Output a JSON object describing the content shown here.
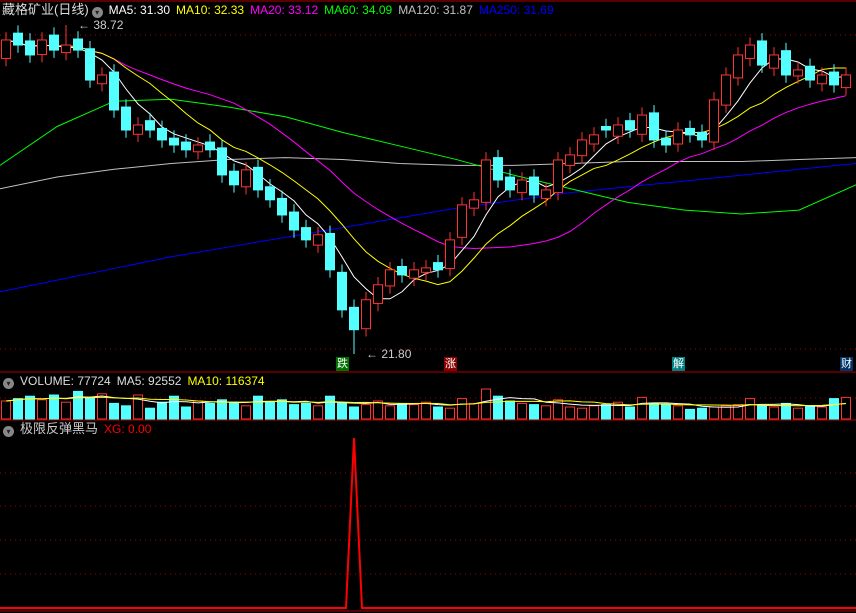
{
  "header": {
    "title": "藏格矿业(日线)",
    "ma": [
      {
        "label": "MA5: 31.30",
        "color": "#ffffff"
      },
      {
        "label": "MA10: 32.33",
        "color": "#ffff00"
      },
      {
        "label": "MA20: 33.12",
        "color": "#ff00ff"
      },
      {
        "label": "MA60: 34.09",
        "color": "#00ff00"
      },
      {
        "label": "MA120: 31.87",
        "color": "#c0c0c0"
      },
      {
        "label": "MA250: 31.69",
        "color": "#0000ff"
      }
    ]
  },
  "volume_header": {
    "volume": "VOLUME: 77724",
    "ma5": "MA5: 92552",
    "ma10": "MA10: 116374"
  },
  "indicator_header": {
    "name": "极限反弹黑马",
    "xg": "XG: 0.00"
  },
  "markers": [
    {
      "text": "跌",
      "index": 28,
      "color": "#007000"
    },
    {
      "text": "涨",
      "index": 37,
      "color": "#8b0000"
    },
    {
      "text": "解",
      "index": 56,
      "color": "#008080"
    },
    {
      "text": "财",
      "index": 70,
      "color": "#003366"
    }
  ],
  "chart_data": {
    "type": "candlestick",
    "title": "藏格矿业(日线)",
    "price_range": [
      21.8,
      38.72
    ],
    "annotations": [
      {
        "text": "38.72",
        "index": 5,
        "type": "high"
      },
      {
        "text": "21.80",
        "index": 29,
        "type": "low"
      }
    ],
    "open": [
      37.0,
      38.3,
      37.9,
      37.2,
      38.2,
      37.3,
      38.0,
      37.5,
      35.7,
      36.3,
      34.5,
      33.1,
      33.8,
      33.4,
      32.9,
      32.7,
      32.2,
      32.7,
      32.4,
      31.2,
      30.4,
      31.4,
      30.4,
      29.8,
      29.1,
      28.3,
      27.4,
      28.0,
      26.0,
      24.2,
      23.1,
      24.4,
      25.3,
      26.3,
      25.7,
      26.0,
      26.5,
      26.2,
      27.8,
      29.3,
      29.6,
      31.9,
      30.9,
      30.1,
      30.9,
      29.8,
      30.1,
      31.5,
      32.0,
      32.6,
      33.5,
      33.0,
      33.8,
      33.1,
      34.2,
      32.9,
      32.6,
      33.4,
      33.2,
      32.7,
      34.6,
      36.0,
      37.0,
      37.9,
      36.5,
      37.4,
      36.1,
      36.6,
      35.7,
      36.3,
      35.5
    ],
    "close": [
      37.95,
      37.69,
      37.18,
      37.95,
      37.43,
      37.69,
      37.43,
      35.89,
      36.15,
      34.35,
      33.32,
      33.58,
      33.32,
      32.81,
      32.55,
      32.3,
      32.55,
      32.3,
      31.01,
      30.5,
      31.27,
      30.24,
      29.73,
      28.95,
      28.18,
      27.67,
      27.93,
      26.13,
      24.07,
      23.05,
      24.59,
      25.36,
      26.13,
      25.87,
      26.13,
      26.23,
      26.13,
      27.67,
      29.47,
      29.73,
      31.78,
      30.75,
      30.24,
      30.75,
      29.98,
      30.24,
      31.78,
      32.04,
      32.81,
      33.07,
      33.32,
      33.58,
      33.32,
      34.09,
      32.81,
      32.55,
      33.32,
      33.07,
      32.81,
      34.87,
      36.15,
      37.18,
      37.69,
      36.66,
      37.18,
      36.15,
      36.41,
      35.89,
      36.15,
      35.64,
      36.15
    ],
    "ma60": [
      31.5,
      33.5,
      34.8,
      34.9,
      34.5,
      34.0,
      33.2,
      32.5,
      31.8,
      31.0,
      30.3,
      29.6,
      29.2,
      29.0,
      29.2,
      30.5
    ],
    "ma120": [
      30.3,
      30.9,
      31.3,
      31.6,
      31.8,
      31.9,
      31.8,
      31.6,
      31.5,
      31.5,
      31.6,
      31.7,
      31.7,
      31.7,
      31.8,
      31.9
    ],
    "ma250": [
      25.0,
      25.6,
      26.2,
      26.8,
      27.3,
      27.8,
      28.3,
      28.8,
      29.3,
      29.7,
      30.1,
      30.4,
      30.7,
      31.0,
      31.3,
      31.6
    ],
    "volume": [
      150000,
      170000,
      190000,
      160000,
      200000,
      140000,
      230000,
      180000,
      210000,
      130000,
      110000,
      200000,
      90000,
      140000,
      190000,
      100000,
      150000,
      130000,
      160000,
      140000,
      110000,
      190000,
      140000,
      160000,
      120000,
      130000,
      110000,
      190000,
      130000,
      100000,
      120000,
      150000,
      110000,
      130000,
      120000,
      140000,
      100000,
      90000,
      170000,
      130000,
      250000,
      190000,
      150000,
      130000,
      120000,
      110000,
      160000,
      100000,
      90000,
      110000,
      120000,
      140000,
      100000,
      180000,
      130000,
      120000,
      110000,
      80000,
      90000,
      100000,
      110000,
      120000,
      170000,
      110000,
      100000,
      130000,
      90000,
      110000,
      100000,
      170000,
      180000
    ],
    "xg": {
      "signal_index": 29,
      "value_at_signal": 1,
      "current": 0.0
    }
  }
}
